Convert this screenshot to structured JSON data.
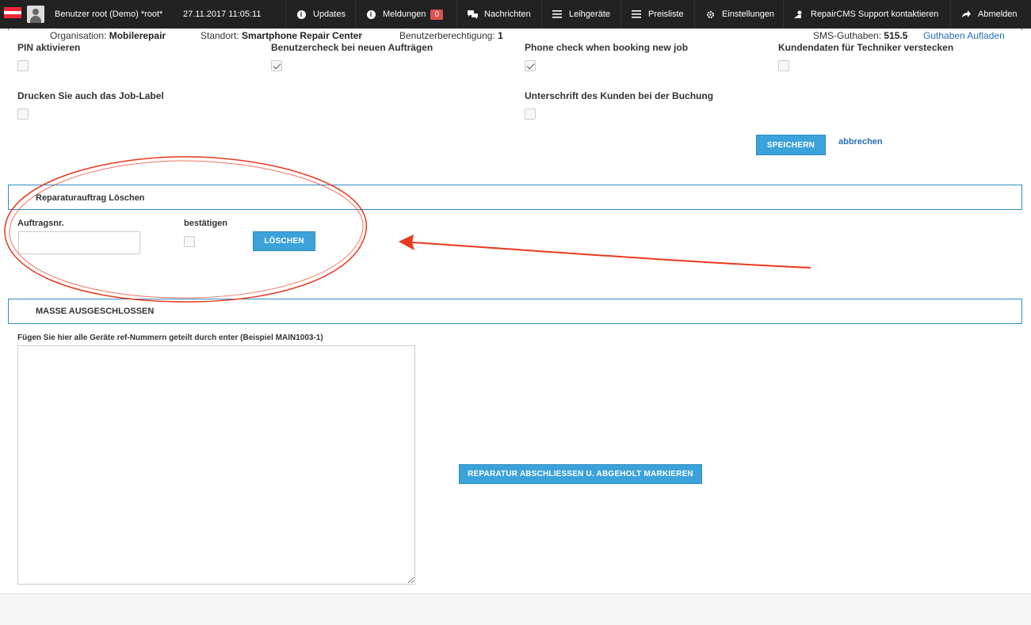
{
  "topbar": {
    "user": "Benutzer root (Demo) *root*",
    "datetime": "27.11.2017 11:05:11",
    "nav": {
      "updates": "Updates",
      "meldungen": "Meldungen",
      "meldungen_count": "0",
      "nachrichten": "Nachrichten",
      "leihgeraete": "Leihgeräte",
      "preisliste": "Preisliste",
      "einstellungen": "Einstellungen",
      "support": "RepairCMS Support kontaktieren",
      "abmelden": "Abmelden"
    }
  },
  "info": {
    "org_label": "Organisation:",
    "org_value": "Mobilerepair",
    "site_label": "Standort:",
    "site_value": "Smartphone Repair Center",
    "perm_label": "Benutzerberechtigung:",
    "perm_value": "1",
    "sms_label": "SMS-Guthaben:",
    "sms_value": "515.5",
    "topup_link": "Guthaben Aufladen"
  },
  "settings": {
    "pin": "PIN aktivieren",
    "usercheck": "Benutzercheck bei neuen Aufträgen",
    "phonecheck": "Phone check when booking new job",
    "hidecustomer": "Kundendaten für Techniker verstecken",
    "joblabel": "Drucken Sie auch das Job-Label",
    "signature": "Unterschrift des Kunden bei der Buchung",
    "save": "SPEICHERN",
    "cancel": "abbrechen"
  },
  "delete_panel": {
    "title": "Reparaturauftrag Löschen",
    "order_label": "Auftragsnr.",
    "order_value": "",
    "confirm_label": "bestätigen",
    "delete_button": "LÖSCHEN"
  },
  "mass_panel": {
    "title": "MASSE AUSGESCHLOSSEN",
    "instructions": "Fügen Sie hier alle Geräte ref-Nummern geteilt durch enter (Beispiel MAIN1003-1)",
    "textarea_value": "",
    "action_button": "REPARATUR ABSCHLIESSEN U. ABGEHOLT MARKIEREN"
  },
  "colors": {
    "accent": "#3ca2da",
    "annotation": "#e8391e",
    "topbar": "#222222",
    "badge": "#d9534f"
  }
}
